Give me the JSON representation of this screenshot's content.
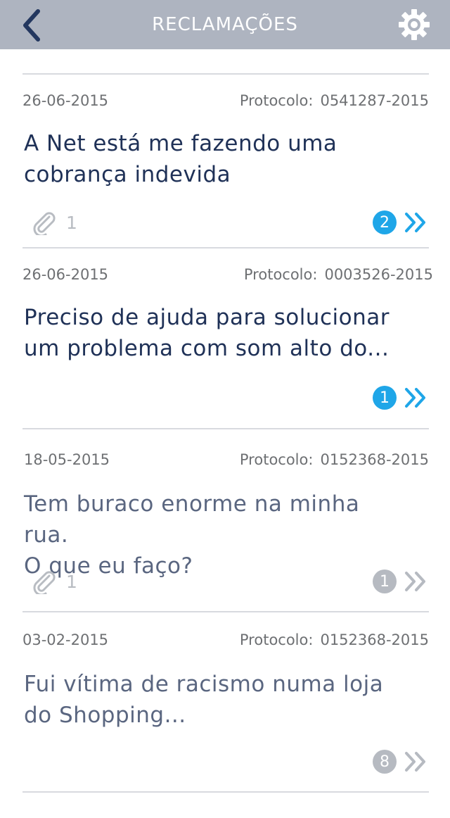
{
  "header": {
    "title": "RECLAMAÇÕES",
    "back_icon": "chevron-left-icon",
    "settings_icon": "gear-icon"
  },
  "colors": {
    "header_bg": "#aeb4c0",
    "accent": "#1fa6e8",
    "muted": "#b6bac1",
    "title_dark": "#1f3157",
    "title_read": "#5a6680"
  },
  "complaints": [
    {
      "date": "26-06-2015",
      "protocol_label": "Protocolo:",
      "protocol": "0541287-2015",
      "title_line1": "A Net está me fazendo uma",
      "title_line2": "cobrança indevida",
      "attachments": "1",
      "count": "2",
      "state": "unread"
    },
    {
      "date": "26-06-2015",
      "protocol_label": "Protocolo:",
      "protocol": "0003526-2015",
      "title_line1": "Preciso de ajuda para solucionar",
      "title_line2": "um problema com som alto do...",
      "attachments": "",
      "count": "1",
      "state": "unread"
    },
    {
      "date": "18-05-2015",
      "protocol_label": "Protocolo:",
      "protocol": "0152368-2015",
      "title_line1": "Tem buraco enorme na minha rua.",
      "title_line2": "O que eu faço?",
      "attachments": "1",
      "count": "1",
      "state": "read"
    },
    {
      "date": "03-02-2015",
      "protocol_label": "Protocolo:",
      "protocol": "0152368-2015",
      "title_line1": "Fui vítima de racismo numa loja",
      "title_line2": "do Shopping...",
      "attachments": "",
      "count": "8",
      "state": "read"
    }
  ]
}
